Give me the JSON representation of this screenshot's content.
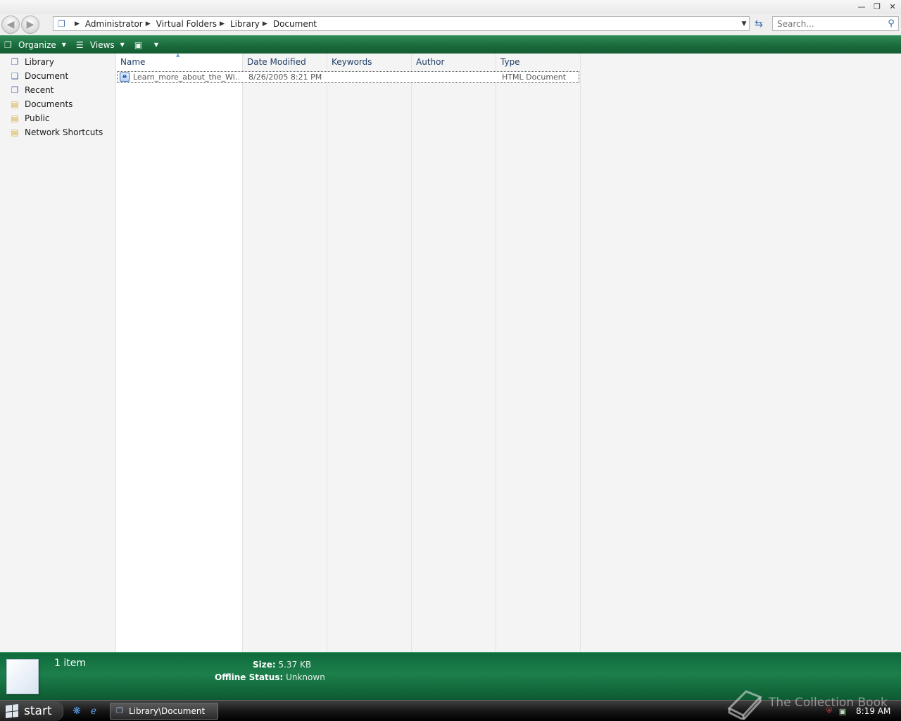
{
  "address": {
    "breadcrumbs": [
      "Administrator",
      "Virtual Folders",
      "Library",
      "Document"
    ]
  },
  "search": {
    "placeholder": "Search..."
  },
  "commands": {
    "organize": "Organize",
    "views": "Views"
  },
  "navpane": {
    "items": [
      {
        "label": "Library",
        "icon": "library-icon"
      },
      {
        "label": "Document",
        "icon": "document-icon"
      },
      {
        "label": "Recent",
        "icon": "recent-icon"
      },
      {
        "label": "Documents",
        "icon": "folder-icon"
      },
      {
        "label": "Public",
        "icon": "folder-icon"
      },
      {
        "label": "Network Shortcuts",
        "icon": "folder-icon"
      }
    ]
  },
  "columns": [
    "Name",
    "Date Modified",
    "Keywords",
    "Author",
    "Type"
  ],
  "files": [
    {
      "name": "Learn_more_about_the_Wi...",
      "date": "8/26/2005 8:21 PM",
      "keywords": "",
      "author": "",
      "type": "HTML Document"
    }
  ],
  "details": {
    "count": "1 item",
    "size_label": "Size:",
    "size_value": "5.37 KB",
    "offline_label": "Offline Status:",
    "offline_value": "Unknown"
  },
  "taskbar": {
    "start": "start",
    "window_button": "Library\\Document",
    "clock": "8:19 AM"
  },
  "watermark": "The Collection Book",
  "colors": {
    "accent_green": "#1a6b3c",
    "selection_border": "#555555"
  }
}
